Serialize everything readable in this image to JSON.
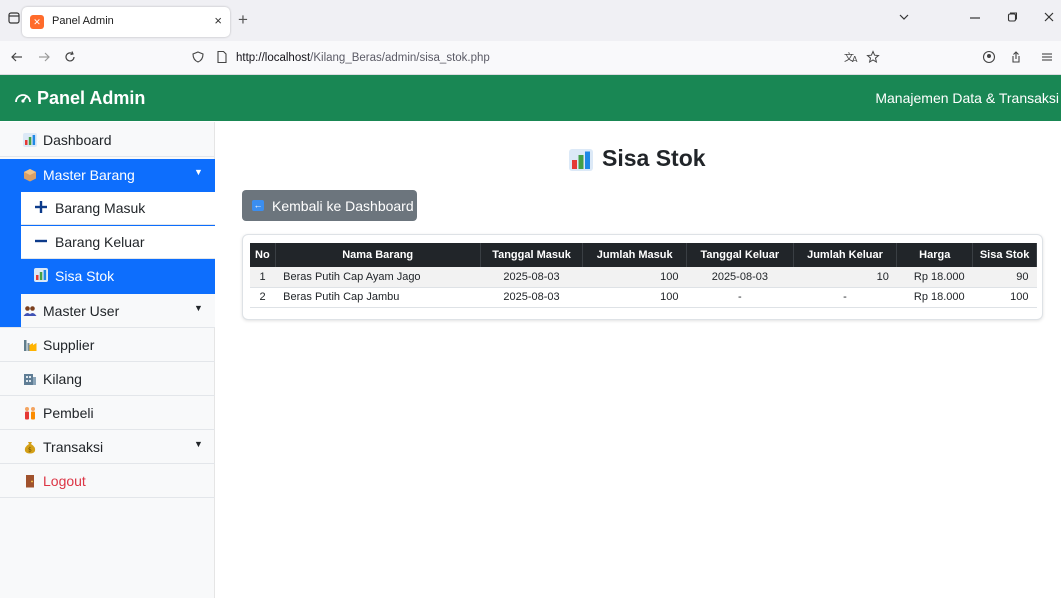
{
  "browser": {
    "tab_title": "Panel Admin",
    "tab_close": "×",
    "new_tab": "+",
    "url_host": "http://localhost",
    "url_path": "/Kilang_Beras/admin/sisa_stok.php"
  },
  "header": {
    "brand": "Panel Admin",
    "tagline": "Manajemen Data & Transaksi"
  },
  "sidebar": {
    "items": [
      {
        "label": "Dashboard",
        "icon": "bar-chart-icon"
      },
      {
        "label": "Master Barang",
        "icon": "box-icon",
        "expanded": true
      },
      {
        "label": "Barang Masuk",
        "icon": "plus-icon"
      },
      {
        "label": "Barang Keluar",
        "icon": "minus-icon"
      },
      {
        "label": "Sisa Stok",
        "icon": "bar-chart-icon",
        "active": true
      },
      {
        "label": "Master User",
        "icon": "users-icon"
      },
      {
        "label": "Supplier",
        "icon": "factory-icon"
      },
      {
        "label": "Kilang",
        "icon": "building-icon"
      },
      {
        "label": "Pembeli",
        "icon": "people-icon"
      },
      {
        "label": "Transaksi",
        "icon": "money-bag-icon"
      },
      {
        "label": "Logout",
        "icon": "door-icon"
      }
    ]
  },
  "main": {
    "title": "Sisa Stok",
    "back_button": "Kembali ke Dashboard",
    "table": {
      "headers": [
        "No",
        "Nama Barang",
        "Tanggal Masuk",
        "Jumlah Masuk",
        "Tanggal Keluar",
        "Jumlah Keluar",
        "Harga",
        "Sisa Stok"
      ],
      "rows": [
        [
          "1",
          "Beras Putih Cap Ayam Jago",
          "2025-08-03",
          "100",
          "2025-08-03",
          "10",
          "Rp 18.000",
          "90"
        ],
        [
          "2",
          "Beras Putih Cap Jambu",
          "2025-08-03",
          "100",
          "-",
          "-",
          "Rp 18.000",
          "100"
        ]
      ]
    }
  },
  "colors": {
    "header_green": "#198754",
    "active_blue": "#0d6efd",
    "table_head": "#212529",
    "button_gray": "#6c757d",
    "logout_red": "#dc3545"
  }
}
